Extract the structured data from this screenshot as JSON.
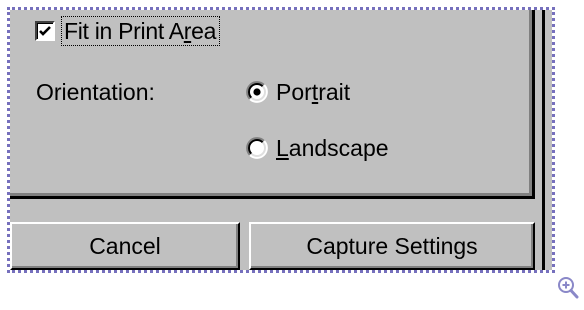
{
  "dialog": {
    "fit_checkbox": {
      "label": "Fit in Print Area",
      "checked": true
    },
    "orientation": {
      "label": "Orientation:",
      "options": [
        {
          "label": "Portrait",
          "selected": true
        },
        {
          "label": "Landscape",
          "selected": false
        }
      ]
    },
    "buttons": {
      "cancel_label": "Cancel",
      "capture_label": "Capture Settings"
    }
  },
  "colors": {
    "dialog_background": "#c0c0c0",
    "selection_border": "#7670bd",
    "zoom_icon": "#8a88c8"
  },
  "icons": {
    "zoom": "zoom-in-icon",
    "check": "checkmark-icon"
  }
}
